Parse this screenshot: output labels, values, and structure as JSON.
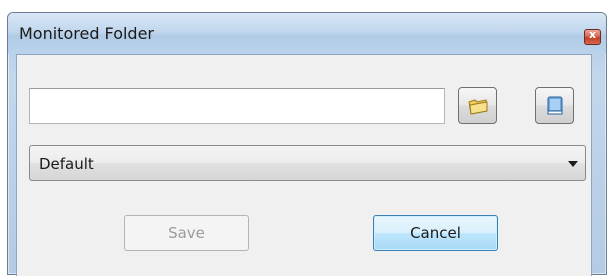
{
  "window": {
    "title": "Monitored Folder",
    "close_label": "x"
  },
  "folder": {
    "path_value": "",
    "browse_icon": "folder-icon",
    "book_icon": "book-icon"
  },
  "profile_select": {
    "selected": "Default"
  },
  "buttons": {
    "save_label": "Save",
    "save_enabled": false,
    "cancel_label": "Cancel"
  },
  "colors": {
    "title_bar": "#c2d7ee",
    "client_bg": "#f0f0f0",
    "close_red": "#c23e25",
    "focus_blue": "#3c7fb1"
  }
}
